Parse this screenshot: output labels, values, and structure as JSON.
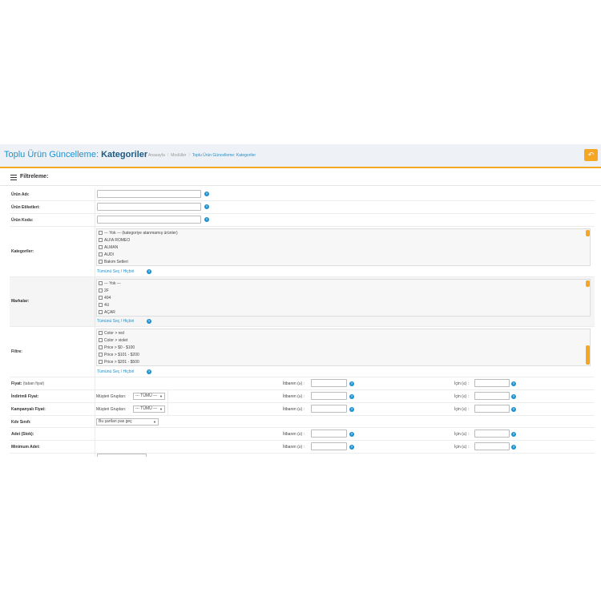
{
  "header": {
    "title_main": "Toplu Ürün Güncelleme:",
    "title_bold": "Kategoriler",
    "breadcrumbs": [
      "Anasayfa",
      "Modüller",
      "Toplu Ürün Güncelleme: Kategoriler"
    ],
    "back_icon": "reply-icon",
    "back_glyph": "↶"
  },
  "panel": {
    "title": "Filtreleme:",
    "icon": "list-icon"
  },
  "fields": {
    "product_name": "Ürün Adı:",
    "product_tags": "Ürün Etiketleri:",
    "product_code": "Ürün Kodu:",
    "categories": "Kategoriler:",
    "brands": "Markalar:",
    "filter": "Filtre:",
    "price": "Fiyat:",
    "price_sub": "(taban fiyat)",
    "discount_price": "İndirimli Fiyat:",
    "campaign_price": "Kampanyalı Fiyat:",
    "tax_class": "Kdv Sınıfı:",
    "quantity": "Adet (Stok):",
    "minimum": "Minimum Adet:"
  },
  "lists": {
    "categories": [
      "--- Yok --- (kategoriye atanmamış ürünler)",
      "ALFA ROMEO",
      "ALMAN",
      "AUDI",
      "Bakım Setleri"
    ],
    "brands": [
      "--- Yok ---",
      "2F",
      "404",
      "4U",
      "AÇAR"
    ],
    "filter": [
      "Color > red",
      "Color > violet",
      "Price > $0 - $100",
      "Price > $101 - $200",
      "Price > $201 - $500"
    ]
  },
  "select_all": "Tümünü Seç / Hiçbiri",
  "range": {
    "from": "İtibaren (≥) :",
    "to": "İçin (≤) :"
  },
  "customer_groups_label": "Müşteri Grupları:",
  "customer_groups_value": "--- TÜMÜ ---",
  "tax_class_value": "Bu şartları pas geç",
  "help_glyph": "?",
  "colors": {
    "accent": "#f5a623",
    "link": "#1e91cf",
    "title_dark": "#1b5a85"
  }
}
